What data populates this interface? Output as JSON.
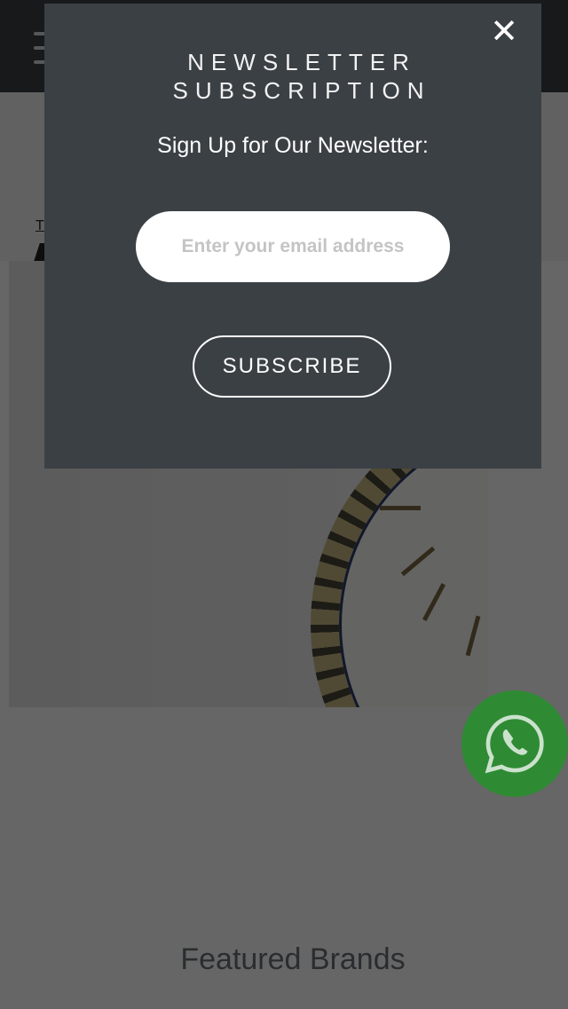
{
  "page": {
    "hero_link_text": "T",
    "featured_title": "Featured Brands"
  },
  "modal": {
    "title": "NEWSLETTER SUBSCRIPTION",
    "subtitle": "Sign Up for Our Newsletter:",
    "email_placeholder": "Enter your email address",
    "email_value": "",
    "subscribe_label": "SUBSCRIBE",
    "close_label": "✕"
  },
  "icons": {
    "menu": "hamburger-menu-icon",
    "close": "close-icon",
    "chat": "whatsapp-icon"
  },
  "colors": {
    "modal_bg": "#3b4045",
    "whatsapp": "#2f8a34"
  }
}
